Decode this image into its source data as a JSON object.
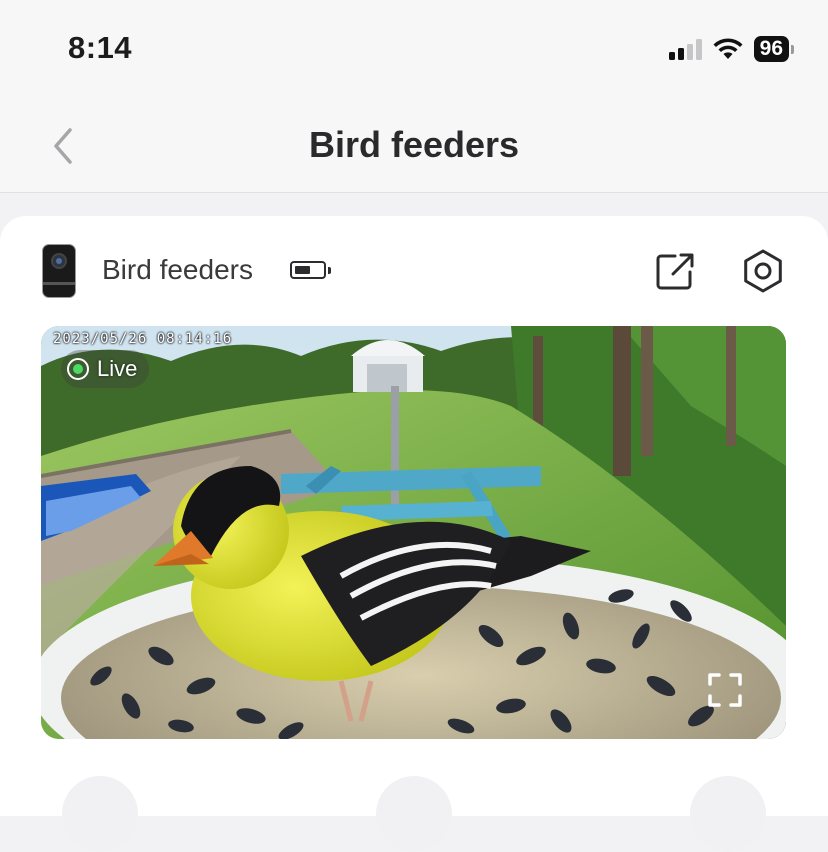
{
  "status_bar": {
    "time": "8:14",
    "battery_percent": "96",
    "signal_bars_active": 2,
    "signal_bars_total": 4
  },
  "nav": {
    "title": "Bird feeders",
    "back_icon": "chevron-left-icon"
  },
  "device": {
    "name": "Bird feeders",
    "battery_level": 0.6,
    "icons": {
      "share": "share-external-icon",
      "settings": "hexagon-settings-icon",
      "fullscreen": "fullscreen-icon"
    }
  },
  "video": {
    "timestamp": "2023/05/26 08:14:16",
    "live_label": "Live",
    "live_color": "#4cd964"
  },
  "colors": {
    "bird_yellow": "#e6e63a",
    "background": "#f2f2f4"
  }
}
